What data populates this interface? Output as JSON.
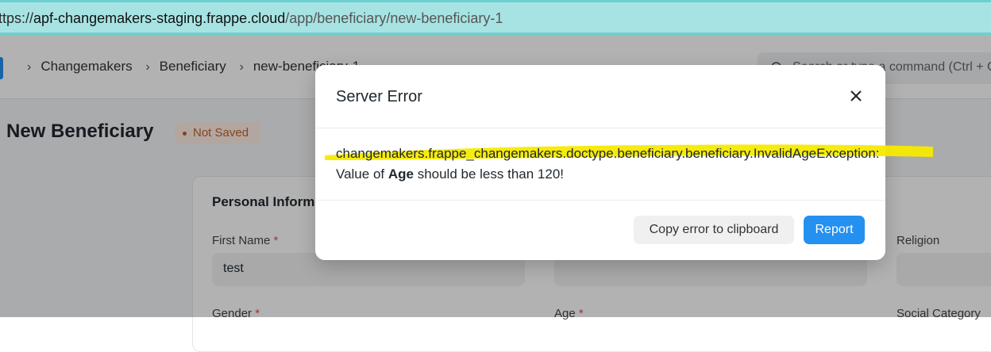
{
  "browser": {
    "url_scheme": "https://",
    "url_host": "apf-changemakers-staging.frappe.cloud",
    "url_path": "/app/beneficiary/new-beneficiary-1"
  },
  "navbar": {
    "breadcrumbs": [
      "Changemakers",
      "Beneficiary",
      "new-beneficiary-1"
    ],
    "search_placeholder": "Search or type a command (Ctrl + G)"
  },
  "page": {
    "title": "New Beneficiary",
    "status_badge": "Not Saved",
    "section_title": "Personal Information",
    "fields": {
      "first_name_label": "First Name",
      "first_name_value": "test",
      "gender_label": "Gender",
      "age_label": "Age",
      "religion_label": "Religion",
      "social_category_label": "Social Category"
    }
  },
  "modal": {
    "title": "Server Error",
    "error_line1": "changemakers.frappe_changemakers.doctype.beneficiary.beneficiary.InvalidAgeException:",
    "error_line2_pre": "Value of ",
    "error_line2_bold": "Age",
    "error_line2_post": " should be less than 120!",
    "copy_button": "Copy error to clipboard",
    "report_button": "Report"
  },
  "colors": {
    "primary": "#2490ef",
    "highlight": "#f5ea00",
    "badge_text": "#c15f2c",
    "url_bar": "#a7e3e3"
  },
  "icons": [
    "search-icon",
    "close-icon",
    "chevron-right-icon"
  ]
}
